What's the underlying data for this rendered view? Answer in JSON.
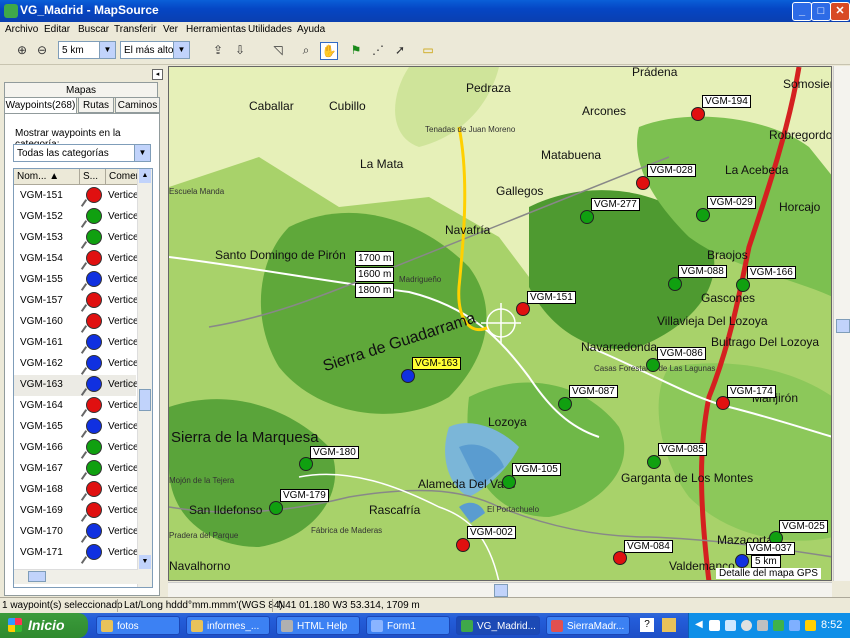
{
  "window": {
    "title": "VG_Madrid - MapSource",
    "min": "_",
    "max": "□",
    "close": "✕"
  },
  "menu": [
    "Archivo",
    "Editar",
    "Buscar",
    "Transferir",
    "Ver",
    "Herramientas",
    "Utilidades",
    "Ayuda"
  ],
  "toolbar": {
    "zoom_value": "5 km",
    "detail_value": "El más alto"
  },
  "sidebar": {
    "tab_maps": "Mapas",
    "tab_waypoints": "Waypoints(268)",
    "tab_routes": "Rutas",
    "tab_tracks": "Caminos",
    "category_label": "Mostrar waypoints en la categoría:",
    "category_value": "Todas las categorías",
    "columns": [
      "Nom...",
      "S...",
      "Comer"
    ],
    "rows": [
      {
        "name": "VGM-151",
        "color": "#e01010",
        "comment": "Vertice"
      },
      {
        "name": "VGM-152",
        "color": "#10a010",
        "comment": "Vertice"
      },
      {
        "name": "VGM-153",
        "color": "#10a010",
        "comment": "Vertice"
      },
      {
        "name": "VGM-154",
        "color": "#e01010",
        "comment": "Vertice"
      },
      {
        "name": "VGM-155",
        "color": "#1030e0",
        "comment": "Vertice"
      },
      {
        "name": "VGM-157",
        "color": "#e01010",
        "comment": "Vertice"
      },
      {
        "name": "VGM-160",
        "color": "#e01010",
        "comment": "Vertice"
      },
      {
        "name": "VGM-161",
        "color": "#1030e0",
        "comment": "Vertice"
      },
      {
        "name": "VGM-162",
        "color": "#1030e0",
        "comment": "Vertice"
      },
      {
        "name": "VGM-163",
        "color": "#1030e0",
        "comment": "Vertice"
      },
      {
        "name": "VGM-164",
        "color": "#e01010",
        "comment": "Vertice"
      },
      {
        "name": "VGM-165",
        "color": "#1030e0",
        "comment": "Vertice"
      },
      {
        "name": "VGM-166",
        "color": "#10a010",
        "comment": "Vertice"
      },
      {
        "name": "VGM-167",
        "color": "#10a010",
        "comment": "Vertice"
      },
      {
        "name": "VGM-168",
        "color": "#e01010",
        "comment": "Vertice"
      },
      {
        "name": "VGM-169",
        "color": "#e01010",
        "comment": "Vertice"
      },
      {
        "name": "VGM-170",
        "color": "#1030e0",
        "comment": "Vertice"
      },
      {
        "name": "VGM-171",
        "color": "#1030e0",
        "comment": "Vertice"
      }
    ]
  },
  "map": {
    "places": [
      "Caballar",
      "Cubillo",
      "Pedraza",
      "Arcones",
      "Prádena",
      "Somosierra",
      "Robregordo",
      "La Mata",
      "Matabuena",
      "Gallegos",
      "La Acebeda",
      "Horcajo",
      "Navafría",
      "Santo Domingo de Pirón",
      "Braojos",
      "Gascones",
      "Villavieja Del Lozoya",
      "Navarredonda",
      "Buitrago Del Lozoya",
      "Sierra de Guadarrama",
      "Sierra de la Marquesa",
      "Lozoya",
      "Manjirón",
      "Alameda Del Valle",
      "Garganta de Los Montes",
      "San Ildefonso",
      "Rascafría",
      "Mazacorta",
      "Valdemanco",
      "Navalhorno"
    ],
    "small_places": [
      "Tenadas de Juan Moreno",
      "Madrigueño",
      "Casas Forestales de Las Lagunas",
      "El Portachuelo",
      "Fábrica de Maderas",
      "Escuela Manda",
      "Pradera del Parque",
      "Mojón de la Tejera"
    ],
    "waypoints": [
      "VGM-194",
      "VGM-028",
      "VGM-277",
      "VGM-029",
      "VGM-088",
      "VGM-166",
      "VGM-151",
      "VGM-086",
      "VGM-163",
      "VGM-087",
      "VGM-174",
      "VGM-085",
      "VGM-180",
      "VGM-105",
      "VGM-179",
      "VGM-002",
      "VGM-084",
      "VGM-025",
      "VGM-037"
    ],
    "elevations": [
      "1700 m",
      "1600 m",
      "1800 m"
    ],
    "scale": "5 km",
    "detail_label": "Detalle del mapa GPS"
  },
  "status": {
    "selection": "1 waypoint(s) seleccionado",
    "format": "Lat/Long hddd°mm.mmm'(WGS 84)",
    "position": "N41 01.180 W3 53.314, 1709 m"
  },
  "taskbar": {
    "start": "Inicio",
    "tasks": [
      "fotos",
      "informes_...",
      "HTML Help",
      "Form1",
      "VG_Madrid...",
      "SierraMadr..."
    ],
    "clock": "8:52"
  }
}
